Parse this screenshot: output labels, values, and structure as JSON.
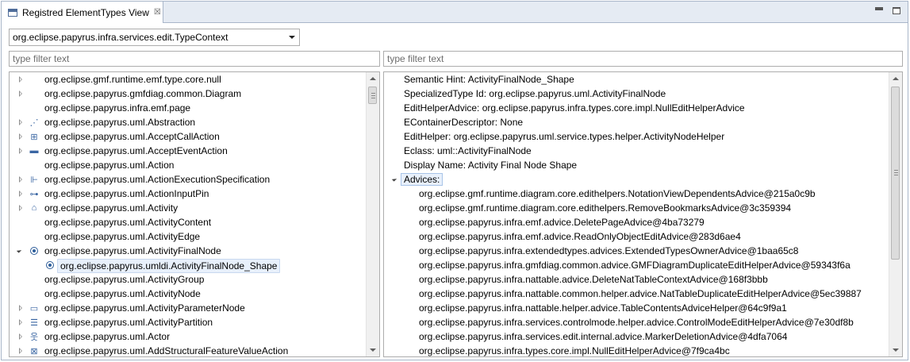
{
  "tab": {
    "title": "Registred ElementTypes View",
    "close_glyph": "☒"
  },
  "context_combo": {
    "selected": "org.eclipse.papyrus.infra.services.edit.TypeContext"
  },
  "left_filter": {
    "placeholder": "type filter text"
  },
  "right_filter": {
    "placeholder": "type filter text"
  },
  "tree": {
    "items": [
      {
        "label": "org.eclipse.gmf.runtime.emf.type.core.null",
        "twisty": "closed",
        "icon": "none"
      },
      {
        "label": "org.eclipse.papyrus.gmfdiag.common.Diagram",
        "twisty": "closed",
        "icon": "none"
      },
      {
        "label": "org.eclipse.papyrus.infra.emf.page",
        "twisty": "none",
        "icon": "none"
      },
      {
        "label": "org.eclipse.papyrus.uml.Abstraction",
        "twisty": "closed",
        "icon": "abstraction-icon"
      },
      {
        "label": "org.eclipse.papyrus.uml.AcceptCallAction",
        "twisty": "closed",
        "icon": "accept-call-action-icon"
      },
      {
        "label": "org.eclipse.papyrus.uml.AcceptEventAction",
        "twisty": "closed",
        "icon": "accept-event-action-icon"
      },
      {
        "label": "org.eclipse.papyrus.uml.Action",
        "twisty": "none",
        "icon": "none"
      },
      {
        "label": "org.eclipse.papyrus.uml.ActionExecutionSpecification",
        "twisty": "closed",
        "icon": "action-execution-specification-icon"
      },
      {
        "label": "org.eclipse.papyrus.uml.ActionInputPin",
        "twisty": "closed",
        "icon": "action-input-pin-icon"
      },
      {
        "label": "org.eclipse.papyrus.uml.Activity",
        "twisty": "closed",
        "icon": "activity-icon"
      },
      {
        "label": "org.eclipse.papyrus.uml.ActivityContent",
        "twisty": "none",
        "icon": "none"
      },
      {
        "label": "org.eclipse.papyrus.uml.ActivityEdge",
        "twisty": "none",
        "icon": "none"
      },
      {
        "label": "org.eclipse.papyrus.uml.ActivityFinalNode",
        "twisty": "open",
        "icon": "activity-final-node-icon"
      },
      {
        "label": "org.eclipse.papyrus.umldi.ActivityFinalNode_Shape",
        "twisty": "none",
        "icon": "activity-final-node-icon",
        "selected": true,
        "child": true
      },
      {
        "label": "org.eclipse.papyrus.uml.ActivityGroup",
        "twisty": "none",
        "icon": "none"
      },
      {
        "label": "org.eclipse.papyrus.uml.ActivityNode",
        "twisty": "none",
        "icon": "none"
      },
      {
        "label": "org.eclipse.papyrus.uml.ActivityParameterNode",
        "twisty": "closed",
        "icon": "activity-parameter-node-icon"
      },
      {
        "label": "org.eclipse.papyrus.uml.ActivityPartition",
        "twisty": "closed",
        "icon": "activity-partition-icon"
      },
      {
        "label": "org.eclipse.papyrus.uml.Actor",
        "twisty": "closed",
        "icon": "actor-icon"
      },
      {
        "label": "org.eclipse.papyrus.uml.AddStructuralFeatureValueAction",
        "twisty": "closed",
        "icon": "add-structural-feature-value-action-icon"
      }
    ]
  },
  "properties": {
    "lines": [
      "Semantic Hint: ActivityFinalNode_Shape",
      "SpecializedType Id: org.eclipse.papyrus.uml.ActivityFinalNode",
      "EditHelperAdvice: org.eclipse.papyrus.infra.types.core.impl.NullEditHelperAdvice",
      "EContainerDescriptor: None",
      "EditHelper: org.eclipse.papyrus.uml.service.types.helper.ActivityNodeHelper",
      "Eclass: uml::ActivityFinalNode",
      "Display Name: Activity Final Node Shape"
    ],
    "advices_label": "Advices:",
    "advices": [
      "org.eclipse.gmf.runtime.diagram.core.edithelpers.NotationViewDependentsAdvice@215a0c9b",
      "org.eclipse.gmf.runtime.diagram.core.edithelpers.RemoveBookmarksAdvice@3c359394",
      "org.eclipse.papyrus.infra.emf.advice.DeletePageAdvice@4ba73279",
      "org.eclipse.papyrus.infra.emf.advice.ReadOnlyObjectEditAdvice@283d6ae4",
      "org.eclipse.papyrus.infra.extendedtypes.advices.ExtendedTypesOwnerAdvice@1baa65c8",
      "org.eclipse.papyrus.infra.gmfdiag.common.advice.GMFDiagramDuplicateEditHelperAdvice@59343f6a",
      "org.eclipse.papyrus.infra.nattable.advice.DeleteNatTableContextAdvice@168f3bbb",
      "org.eclipse.papyrus.infra.nattable.common.helper.advice.NatTableDuplicateEditHelperAdvice@5ec39887",
      "org.eclipse.papyrus.infra.nattable.helper.advice.TableContentsAdviceHelper@64c9f9a1",
      "org.eclipse.papyrus.infra.services.controlmode.helper.advice.ControlModeEditHelperAdvice@7e30df8b",
      "org.eclipse.papyrus.infra.services.edit.internal.advice.MarkerDeletionAdvice@4dfa7064",
      "org.eclipse.papyrus.infra.types.core.impl.NullEditHelperAdvice@7f9ca4bc"
    ]
  }
}
